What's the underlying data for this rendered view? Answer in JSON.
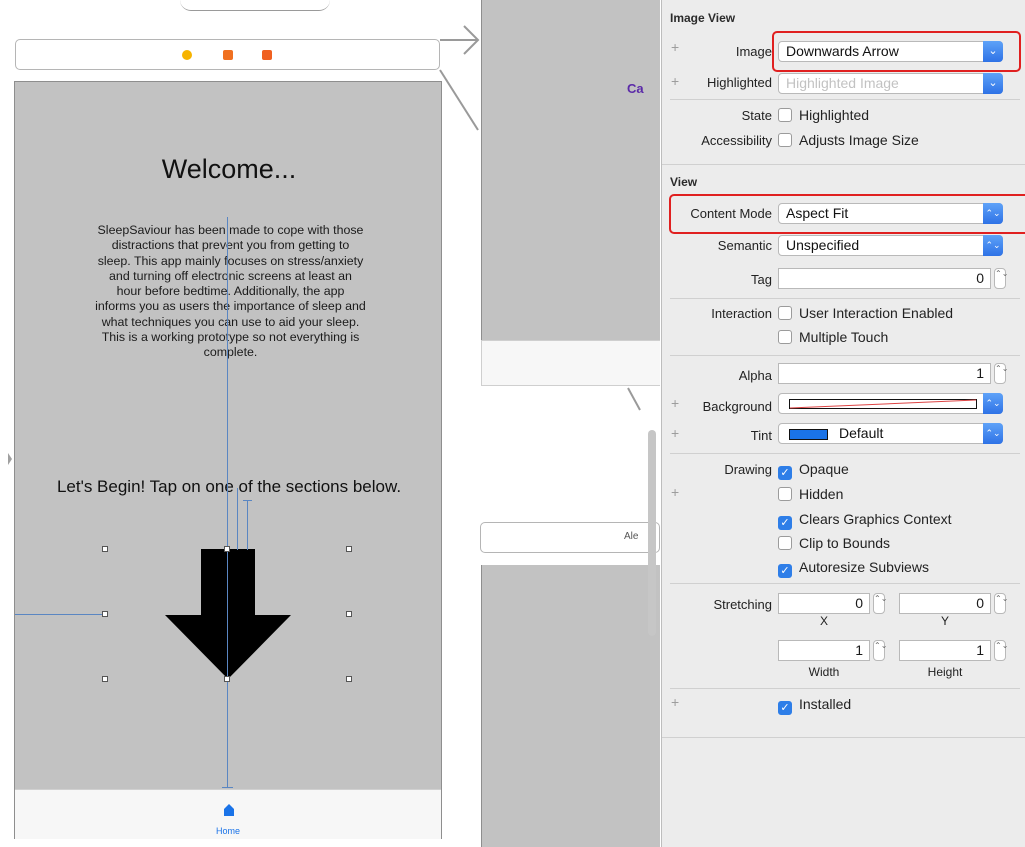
{
  "storyboard": {
    "welcome_title": "Welcome...",
    "intro_text": "SleepSaviour has been made to cope with those distractions that prevent you from getting to sleep. This app mainly focuses on stress/anxiety and turning off electronic screens at least an hour before bedtime. Additionally, the app informs you as users the importance of sleep and what techniques you can use to aid your sleep. This is a working prototype so not everything is complete.",
    "begin_text": "Let's Begin! Tap on one of the sections below.",
    "tab_home_label": "Home",
    "scene2_label_top": "Ca",
    "scene2_label_mid": "Ale",
    "colors": {
      "scene_bg": "#c2c2c2",
      "tint": "#1a73e8",
      "dock_yellow": "#f6b300",
      "dock_orange": "#f07020"
    }
  },
  "inspector": {
    "image_view": {
      "header": "Image View",
      "image_label": "Image",
      "image_value": "Downwards Arrow",
      "highlighted_label": "Highlighted",
      "highlighted_placeholder": "Highlighted Image",
      "state_label": "State",
      "state_checkbox": "Highlighted",
      "accessibility_label": "Accessibility",
      "accessibility_checkbox": "Adjusts Image Size"
    },
    "view": {
      "header": "View",
      "content_mode_label": "Content Mode",
      "content_mode_value": "Aspect Fit",
      "semantic_label": "Semantic",
      "semantic_value": "Unspecified",
      "tag_label": "Tag",
      "tag_value": "0",
      "interaction_label": "Interaction",
      "user_interaction": "User Interaction Enabled",
      "multiple_touch": "Multiple Touch",
      "alpha_label": "Alpha",
      "alpha_value": "1",
      "background_label": "Background",
      "tint_label": "Tint",
      "tint_value": "Default",
      "drawing_label": "Drawing",
      "opaque": "Opaque",
      "hidden": "Hidden",
      "clears_graphics": "Clears Graphics Context",
      "clip_to_bounds": "Clip to Bounds",
      "autoresize": "Autoresize Subviews",
      "stretching_label": "Stretching",
      "stretch_x": "0",
      "stretch_y": "0",
      "x_label": "X",
      "y_label": "Y",
      "stretch_width": "1",
      "stretch_height": "1",
      "width_label": "Width",
      "height_label": "Height",
      "installed": "Installed"
    },
    "plus_symbol": "+",
    "check_symbol": "✓",
    "popup_arrow": "⌄",
    "stepper_symbol": "⌃⌄"
  }
}
